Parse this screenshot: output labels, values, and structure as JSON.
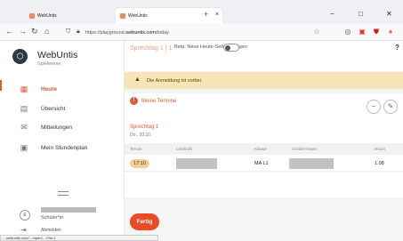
{
  "browser": {
    "tabs": [
      {
        "title": "WebUntis"
      },
      {
        "title": "WebUntis"
      }
    ],
    "new_tab": "+",
    "window_controls": {
      "minimize": "−",
      "maximize": "□",
      "close": "✕"
    },
    "url_prefix": "https://playground.",
    "url_domain": "webuntis.com",
    "url_path": "/today",
    "status_url": "…webuntis.com/…/open/…/?id=1"
  },
  "sidebar": {
    "brand": "WebUntis",
    "school": "Spielwiese",
    "items": [
      {
        "label": "Heute",
        "icon": "today-icon"
      },
      {
        "label": "Übersicht",
        "icon": "overview-icon"
      },
      {
        "label": "Mitteilungen",
        "icon": "mail-icon"
      },
      {
        "label": "Mein Stundenplan",
        "icon": "calendar-icon"
      }
    ],
    "user": {
      "initial": "E",
      "role": "Schüler*in",
      "logout": "Abmelden"
    }
  },
  "main": {
    "faint_title": "Sprechtag 1 | 15.10.2022",
    "beta_label": "Beta: Neue Heute-Seite anzeigen",
    "banner_text": "Die Anmeldung ist vorbei.",
    "error_text": "Meine Termine",
    "day_label": "Sprechtag 1",
    "date": "Do., 20.10.",
    "columns": [
      "Termin",
      "Lehrkraft",
      "Klasse",
      "Schüler*innen",
      "Raum"
    ],
    "row": {
      "time": "17:10",
      "class": "MA L1",
      "room": "1.08"
    },
    "done_button": "Fertig"
  }
}
